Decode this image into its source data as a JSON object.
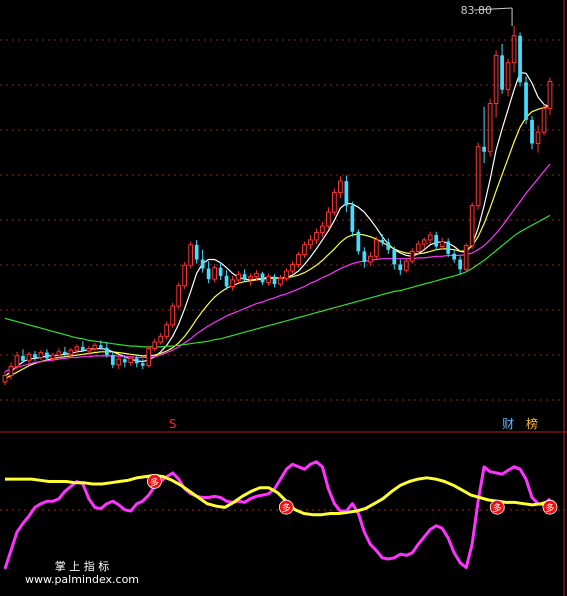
{
  "chart_data": [
    {
      "type": "candlestick",
      "panel": "price",
      "peak_label": "83.80",
      "ylim": [
        38,
        86
      ],
      "up_color": "#ff3333",
      "down_color": "#44ddff",
      "candles": [
        [
          40.2,
          41.5,
          39.8,
          41.0
        ],
        [
          41.0,
          42.6,
          40.5,
          42.1
        ],
        [
          42.1,
          43.9,
          41.7,
          43.4
        ],
        [
          43.4,
          44.2,
          42.5,
          42.8
        ],
        [
          42.8,
          43.9,
          42.4,
          43.6
        ],
        [
          43.6,
          44.0,
          42.8,
          43.2
        ],
        [
          43.2,
          44.1,
          42.9,
          43.8
        ],
        [
          43.8,
          44.2,
          42.9,
          43.1
        ],
        [
          43.1,
          43.8,
          42.7,
          43.5
        ],
        [
          43.5,
          44.3,
          43.1,
          43.9
        ],
        [
          43.9,
          44.5,
          43.2,
          43.6
        ],
        [
          43.6,
          44.4,
          43.3,
          44.1
        ],
        [
          44.1,
          44.8,
          43.7,
          44.5
        ],
        [
          44.5,
          45.2,
          43.9,
          44.0
        ],
        [
          44.0,
          44.6,
          43.5,
          44.3
        ],
        [
          44.3,
          45.0,
          43.9,
          44.7
        ],
        [
          44.7,
          45.3,
          44.2,
          44.4
        ],
        [
          44.4,
          45.1,
          43.2,
          43.5
        ],
        [
          43.5,
          43.9,
          41.9,
          42.3
        ],
        [
          42.3,
          43.4,
          41.8,
          43.0
        ],
        [
          43.0,
          43.5,
          42.0,
          42.6
        ],
        [
          42.6,
          43.4,
          42.2,
          43.1
        ],
        [
          43.1,
          43.6,
          42.0,
          42.5
        ],
        [
          42.5,
          43.0,
          41.8,
          42.2
        ],
        [
          42.2,
          44.6,
          42.0,
          44.3
        ],
        [
          44.3,
          45.5,
          44.0,
          45.1
        ],
        [
          45.1,
          46.2,
          44.8,
          45.8
        ],
        [
          45.8,
          47.6,
          45.4,
          47.2
        ],
        [
          47.2,
          49.9,
          46.8,
          49.5
        ],
        [
          49.5,
          52.4,
          49.1,
          52.0
        ],
        [
          52.0,
          54.9,
          51.6,
          54.5
        ],
        [
          54.5,
          57.4,
          54.1,
          57.0
        ],
        [
          57.0,
          57.6,
          54.7,
          55.2
        ],
        [
          55.2,
          56.4,
          53.6,
          54.1
        ],
        [
          54.1,
          55.0,
          52.3,
          52.8
        ],
        [
          52.8,
          54.6,
          52.4,
          54.2
        ],
        [
          54.2,
          54.9,
          52.7,
          53.2
        ],
        [
          53.2,
          53.9,
          51.5,
          51.9
        ],
        [
          51.9,
          53.2,
          51.4,
          52.7
        ],
        [
          52.7,
          53.8,
          52.3,
          53.4
        ],
        [
          53.4,
          54.0,
          52.5,
          52.8
        ],
        [
          52.8,
          53.5,
          52.0,
          53.1
        ],
        [
          53.1,
          53.9,
          52.6,
          53.5
        ],
        [
          53.5,
          53.7,
          52.1,
          52.4
        ],
        [
          52.4,
          53.5,
          52.0,
          53.1
        ],
        [
          53.1,
          53.4,
          51.8,
          52.2
        ],
        [
          52.2,
          53.3,
          51.9,
          52.9
        ],
        [
          52.9,
          54.1,
          52.6,
          53.8
        ],
        [
          53.8,
          55.0,
          53.5,
          54.6
        ],
        [
          54.6,
          56.1,
          54.2,
          55.8
        ],
        [
          55.8,
          57.4,
          55.4,
          57.0
        ],
        [
          57.0,
          58.2,
          56.5,
          57.6
        ],
        [
          57.6,
          59.0,
          57.1,
          58.5
        ],
        [
          58.5,
          59.8,
          58.0,
          59.3
        ],
        [
          59.3,
          61.6,
          59.0,
          61.0
        ],
        [
          61.0,
          63.9,
          60.6,
          63.4
        ],
        [
          63.4,
          65.4,
          62.7,
          64.8
        ],
        [
          64.8,
          65.5,
          61.0,
          61.8
        ],
        [
          61.8,
          62.3,
          58.0,
          58.6
        ],
        [
          58.6,
          58.9,
          55.8,
          56.2
        ],
        [
          56.2,
          56.7,
          54.2,
          54.9
        ],
        [
          54.9,
          56.1,
          54.4,
          55.6
        ],
        [
          55.6,
          58.0,
          55.1,
          57.6
        ],
        [
          57.6,
          58.3,
          56.9,
          57.3
        ],
        [
          57.3,
          57.8,
          55.9,
          56.4
        ],
        [
          56.4,
          56.8,
          54.0,
          54.6
        ],
        [
          54.6,
          55.2,
          53.3,
          53.9
        ],
        [
          53.9,
          55.3,
          53.6,
          55.0
        ],
        [
          55.0,
          56.6,
          54.7,
          56.2
        ],
        [
          56.2,
          57.5,
          55.9,
          57.1
        ],
        [
          57.1,
          57.9,
          56.5,
          57.6
        ],
        [
          57.6,
          58.6,
          57.1,
          58.2
        ],
        [
          58.2,
          58.6,
          56.4,
          56.8
        ],
        [
          56.8,
          57.9,
          56.4,
          57.4
        ],
        [
          57.4,
          57.8,
          55.5,
          55.9
        ],
        [
          55.9,
          56.4,
          54.8,
          55.2
        ],
        [
          55.2,
          55.6,
          53.4,
          54.0
        ],
        [
          54.0,
          57.2,
          53.8,
          56.9
        ],
        [
          56.9,
          62.2,
          56.5,
          61.8
        ],
        [
          61.8,
          69.5,
          61.3,
          69.0
        ],
        [
          69.0,
          73.9,
          67.0,
          68.4
        ],
        [
          68.4,
          74.9,
          67.8,
          74.3
        ],
        [
          74.3,
          80.8,
          72.6,
          80.2
        ],
        [
          80.2,
          81.6,
          75.5,
          76.0
        ],
        [
          76.0,
          79.8,
          75.2,
          79.3
        ],
        [
          79.3,
          83.8,
          78.1,
          82.6
        ],
        [
          82.6,
          83.0,
          76.4,
          76.9
        ],
        [
          76.9,
          77.6,
          71.8,
          72.3
        ],
        [
          72.3,
          72.8,
          68.7,
          69.4
        ],
        [
          69.4,
          71.6,
          68.3,
          70.8
        ],
        [
          70.8,
          74.2,
          70.4,
          73.7
        ],
        [
          73.7,
          77.5,
          72.9,
          77.0
        ]
      ],
      "series": [
        {
          "name": "",
          "color": "#ffffff",
          "values": [
            40.9,
            41.5,
            42.1,
            42.7,
            43.0,
            43.1,
            43.2,
            43.4,
            43.4,
            43.5,
            43.6,
            43.7,
            43.9,
            44.0,
            44.2,
            44.3,
            44.3,
            44.2,
            43.9,
            43.6,
            43.3,
            43.0,
            42.8,
            42.7,
            42.9,
            43.3,
            43.9,
            44.7,
            45.8,
            47.3,
            49.2,
            51.3,
            53.5,
            54.7,
            55.2,
            55.2,
            54.8,
            54.2,
            53.5,
            53.0,
            52.8,
            52.7,
            52.8,
            52.9,
            53.0,
            53.0,
            52.9,
            53.0,
            53.3,
            53.8,
            54.6,
            55.5,
            56.5,
            57.6,
            58.7,
            60.0,
            61.5,
            62.1,
            62.0,
            61.6,
            61.0,
            60.1,
            59.1,
            58.0,
            57.1,
            56.4,
            56.0,
            55.7,
            55.6,
            55.9,
            56.4,
            57.0,
            57.3,
            57.4,
            57.2,
            56.8,
            56.2,
            56.1,
            57.0,
            59.0,
            61.8,
            65.0,
            68.6,
            71.2,
            73.6,
            76.0,
            78.1,
            78.0,
            76.8,
            75.1,
            74.2,
            73.9
          ]
        },
        {
          "name": "",
          "color": "#ffff44",
          "values": [
            40.6,
            41.0,
            41.4,
            41.8,
            42.2,
            42.5,
            42.7,
            42.9,
            43.1,
            43.2,
            43.3,
            43.4,
            43.5,
            43.6,
            43.7,
            43.8,
            43.9,
            43.9,
            43.9,
            43.8,
            43.7,
            43.6,
            43.5,
            43.4,
            43.4,
            43.5,
            43.7,
            44.0,
            44.4,
            45.0,
            45.8,
            46.8,
            47.9,
            48.9,
            49.8,
            50.6,
            51.2,
            51.7,
            52.0,
            52.3,
            52.5,
            52.6,
            52.7,
            52.8,
            52.9,
            52.9,
            52.9,
            53.0,
            53.1,
            53.3,
            53.6,
            54.0,
            54.5,
            55.1,
            55.8,
            56.5,
            57.3,
            57.9,
            58.2,
            58.3,
            58.2,
            58.0,
            57.7,
            57.3,
            56.9,
            56.5,
            56.2,
            56.0,
            55.9,
            55.9,
            56.0,
            56.2,
            56.4,
            56.5,
            56.5,
            56.4,
            56.2,
            56.3,
            56.9,
            58.0,
            59.6,
            61.5,
            63.6,
            65.6,
            67.6,
            69.6,
            71.4,
            72.6,
            73.3,
            73.6,
            73.8,
            74.0
          ]
        },
        {
          "name": "",
          "color": "#ff33ff",
          "values": [
            41.5,
            41.8,
            42.0,
            42.2,
            42.4,
            42.6,
            42.7,
            42.8,
            42.9,
            43.0,
            43.1,
            43.2,
            43.2,
            43.3,
            43.3,
            43.4,
            43.4,
            43.4,
            43.4,
            43.4,
            43.3,
            43.3,
            43.2,
            43.2,
            43.2,
            43.3,
            43.5,
            43.8,
            44.1,
            44.5,
            45.0,
            45.5,
            46.1,
            46.6,
            47.1,
            47.5,
            47.9,
            48.3,
            48.6,
            48.9,
            49.2,
            49.5,
            49.8,
            50.0,
            50.3,
            50.5,
            50.8,
            51.0,
            51.3,
            51.6,
            51.9,
            52.3,
            52.6,
            53.0,
            53.3,
            53.7,
            54.1,
            54.4,
            54.7,
            54.9,
            55.0,
            55.1,
            55.2,
            55.3,
            55.3,
            55.3,
            55.3,
            55.3,
            55.3,
            55.4,
            55.4,
            55.5,
            55.6,
            55.6,
            55.7,
            55.7,
            55.7,
            55.8,
            56.0,
            56.4,
            56.9,
            57.6,
            58.4,
            59.3,
            60.3,
            61.3,
            62.3,
            63.3,
            64.2,
            65.1,
            66.0,
            66.9
          ]
        },
        {
          "name": "",
          "color": "#33dd33",
          "values": [
            48.0,
            47.8,
            47.6,
            47.4,
            47.2,
            47.0,
            46.8,
            46.6,
            46.4,
            46.2,
            46.0,
            45.8,
            45.6,
            45.5,
            45.3,
            45.2,
            45.1,
            45.0,
            44.9,
            44.8,
            44.7,
            44.6,
            44.6,
            44.5,
            44.5,
            44.5,
            44.5,
            44.6,
            44.6,
            44.7,
            44.8,
            44.9,
            45.0,
            45.1,
            45.2,
            45.4,
            45.5,
            45.7,
            45.9,
            46.1,
            46.3,
            46.5,
            46.7,
            46.9,
            47.1,
            47.3,
            47.5,
            47.7,
            47.9,
            48.1,
            48.3,
            48.5,
            48.7,
            48.9,
            49.1,
            49.3,
            49.5,
            49.7,
            49.9,
            50.1,
            50.3,
            50.5,
            50.7,
            50.9,
            51.1,
            51.3,
            51.4,
            51.6,
            51.8,
            52.0,
            52.2,
            52.4,
            52.6,
            52.8,
            53.0,
            53.2,
            53.4,
            53.7,
            54.1,
            54.6,
            55.1,
            55.7,
            56.3,
            56.9,
            57.5,
            58.1,
            58.6,
            59.0,
            59.4,
            59.8,
            60.2,
            60.6
          ]
        }
      ],
      "markers": [
        {
          "text": "S",
          "color": "#ff2222",
          "index": 28
        },
        {
          "text": "财",
          "color": "#66bbff",
          "index": 84
        },
        {
          "text": "榜",
          "color": "#ffbb33",
          "index": 88
        }
      ]
    },
    {
      "type": "line",
      "panel": "indicator",
      "ylim": [
        0,
        100
      ],
      "series": [
        {
          "name": "",
          "color": "#ff33ff",
          "values": [
            5,
            20,
            35,
            42,
            48,
            55,
            58,
            60,
            60,
            62,
            68,
            72,
            76,
            74,
            62,
            55,
            54,
            58,
            60,
            57,
            53,
            52,
            58,
            60,
            65,
            72,
            76,
            80,
            83,
            78,
            70,
            66,
            64,
            63,
            63,
            64,
            63,
            60,
            59,
            60,
            59,
            62,
            64,
            65,
            66,
            70,
            78,
            86,
            90,
            88,
            86,
            90,
            92,
            88,
            70,
            58,
            52,
            52,
            58,
            50,
            35,
            25,
            20,
            14,
            13,
            14,
            17,
            16,
            18,
            25,
            31,
            37,
            40,
            38,
            30,
            18,
            10,
            6,
            25,
            60,
            88,
            84,
            83,
            82,
            85,
            88,
            86,
            78,
            63,
            58,
            57,
            62
          ]
        },
        {
          "name": "",
          "color": "#ffff33",
          "values": [
            78,
            78,
            78,
            78,
            77,
            76,
            76,
            76,
            75,
            75,
            74,
            74,
            75,
            76,
            77,
            79,
            80,
            81,
            80,
            77,
            73,
            68,
            63,
            58,
            56,
            55,
            59,
            64,
            68,
            71,
            71,
            67,
            60,
            53,
            50,
            49,
            49,
            50,
            50,
            51,
            52,
            54,
            58,
            62,
            68,
            73,
            76,
            78,
            79,
            78,
            76,
            73,
            69,
            65,
            63,
            61,
            60,
            59,
            59,
            58,
            57,
            58,
            60
          ]
        }
      ],
      "markers": [
        {
          "text": "多",
          "index": 17
        },
        {
          "text": "多",
          "index": 32
        },
        {
          "text": "多",
          "index": 56
        },
        {
          "text": "多",
          "index": 62
        }
      ]
    }
  ],
  "watermark": {
    "line1": "掌 上 指 标",
    "line2": "www.palmindex.com"
  }
}
